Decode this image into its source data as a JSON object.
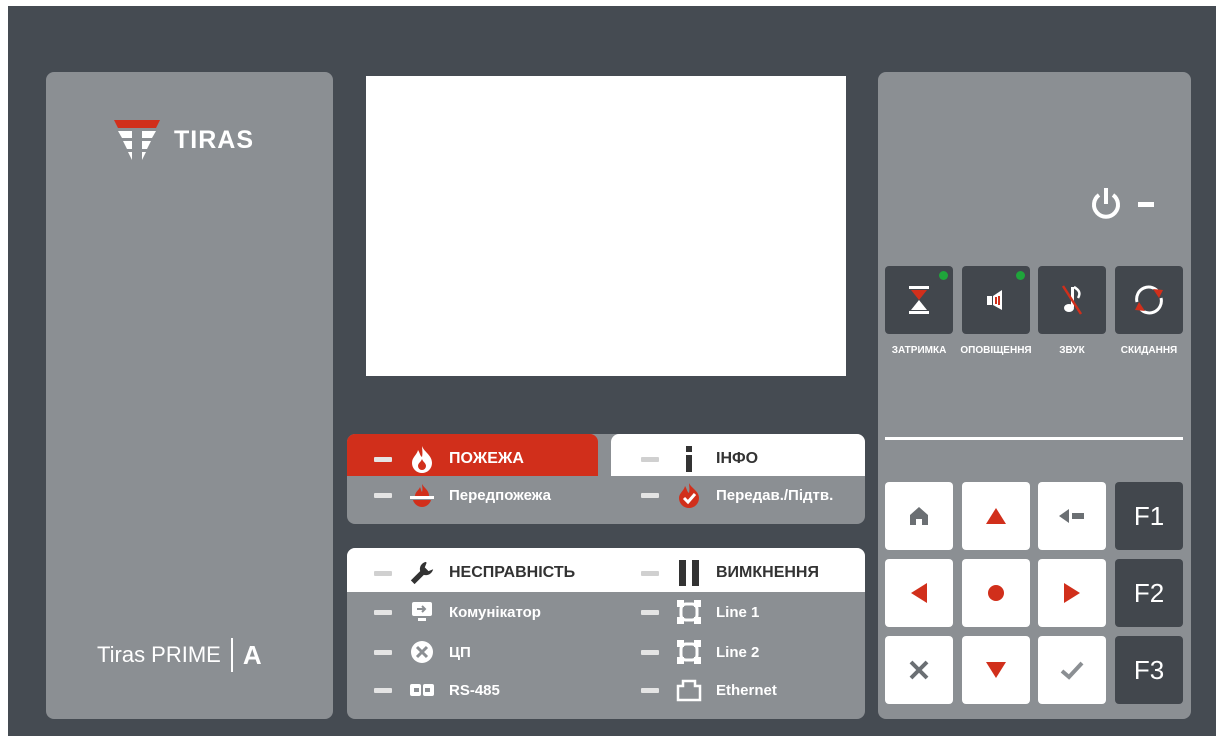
{
  "brand": {
    "logo_text": "TIRAS",
    "product_name": "Tiras PRIME",
    "model": "A"
  },
  "colors": {
    "accent_red": "#d12f1b",
    "led_green": "#1fa53b",
    "panel_gray": "#8b8f93",
    "frame_dark": "#454b52"
  },
  "indicators": {
    "fire": "ПОЖЕЖА",
    "info": "ІНФО",
    "prefire": "Передпожежа",
    "transfer": "Передав./Підтв.",
    "fault": "НЕСПРАВНІСТЬ",
    "disable": "ВИМКНЕННЯ",
    "communicator": "Комунікатор",
    "cpu": "ЦП",
    "rs485": "RS-485",
    "line1": "Line 1",
    "line2": "Line 2",
    "ethernet": "Ethernet"
  },
  "state_buttons": {
    "delay": "ЗАТРИМКА",
    "alert": "ОПОВІЩЕННЯ",
    "sound": "ЗВУК",
    "reset": "СКИДАННЯ"
  },
  "function_keys": {
    "f1": "F1",
    "f2": "F2",
    "f3": "F3"
  }
}
